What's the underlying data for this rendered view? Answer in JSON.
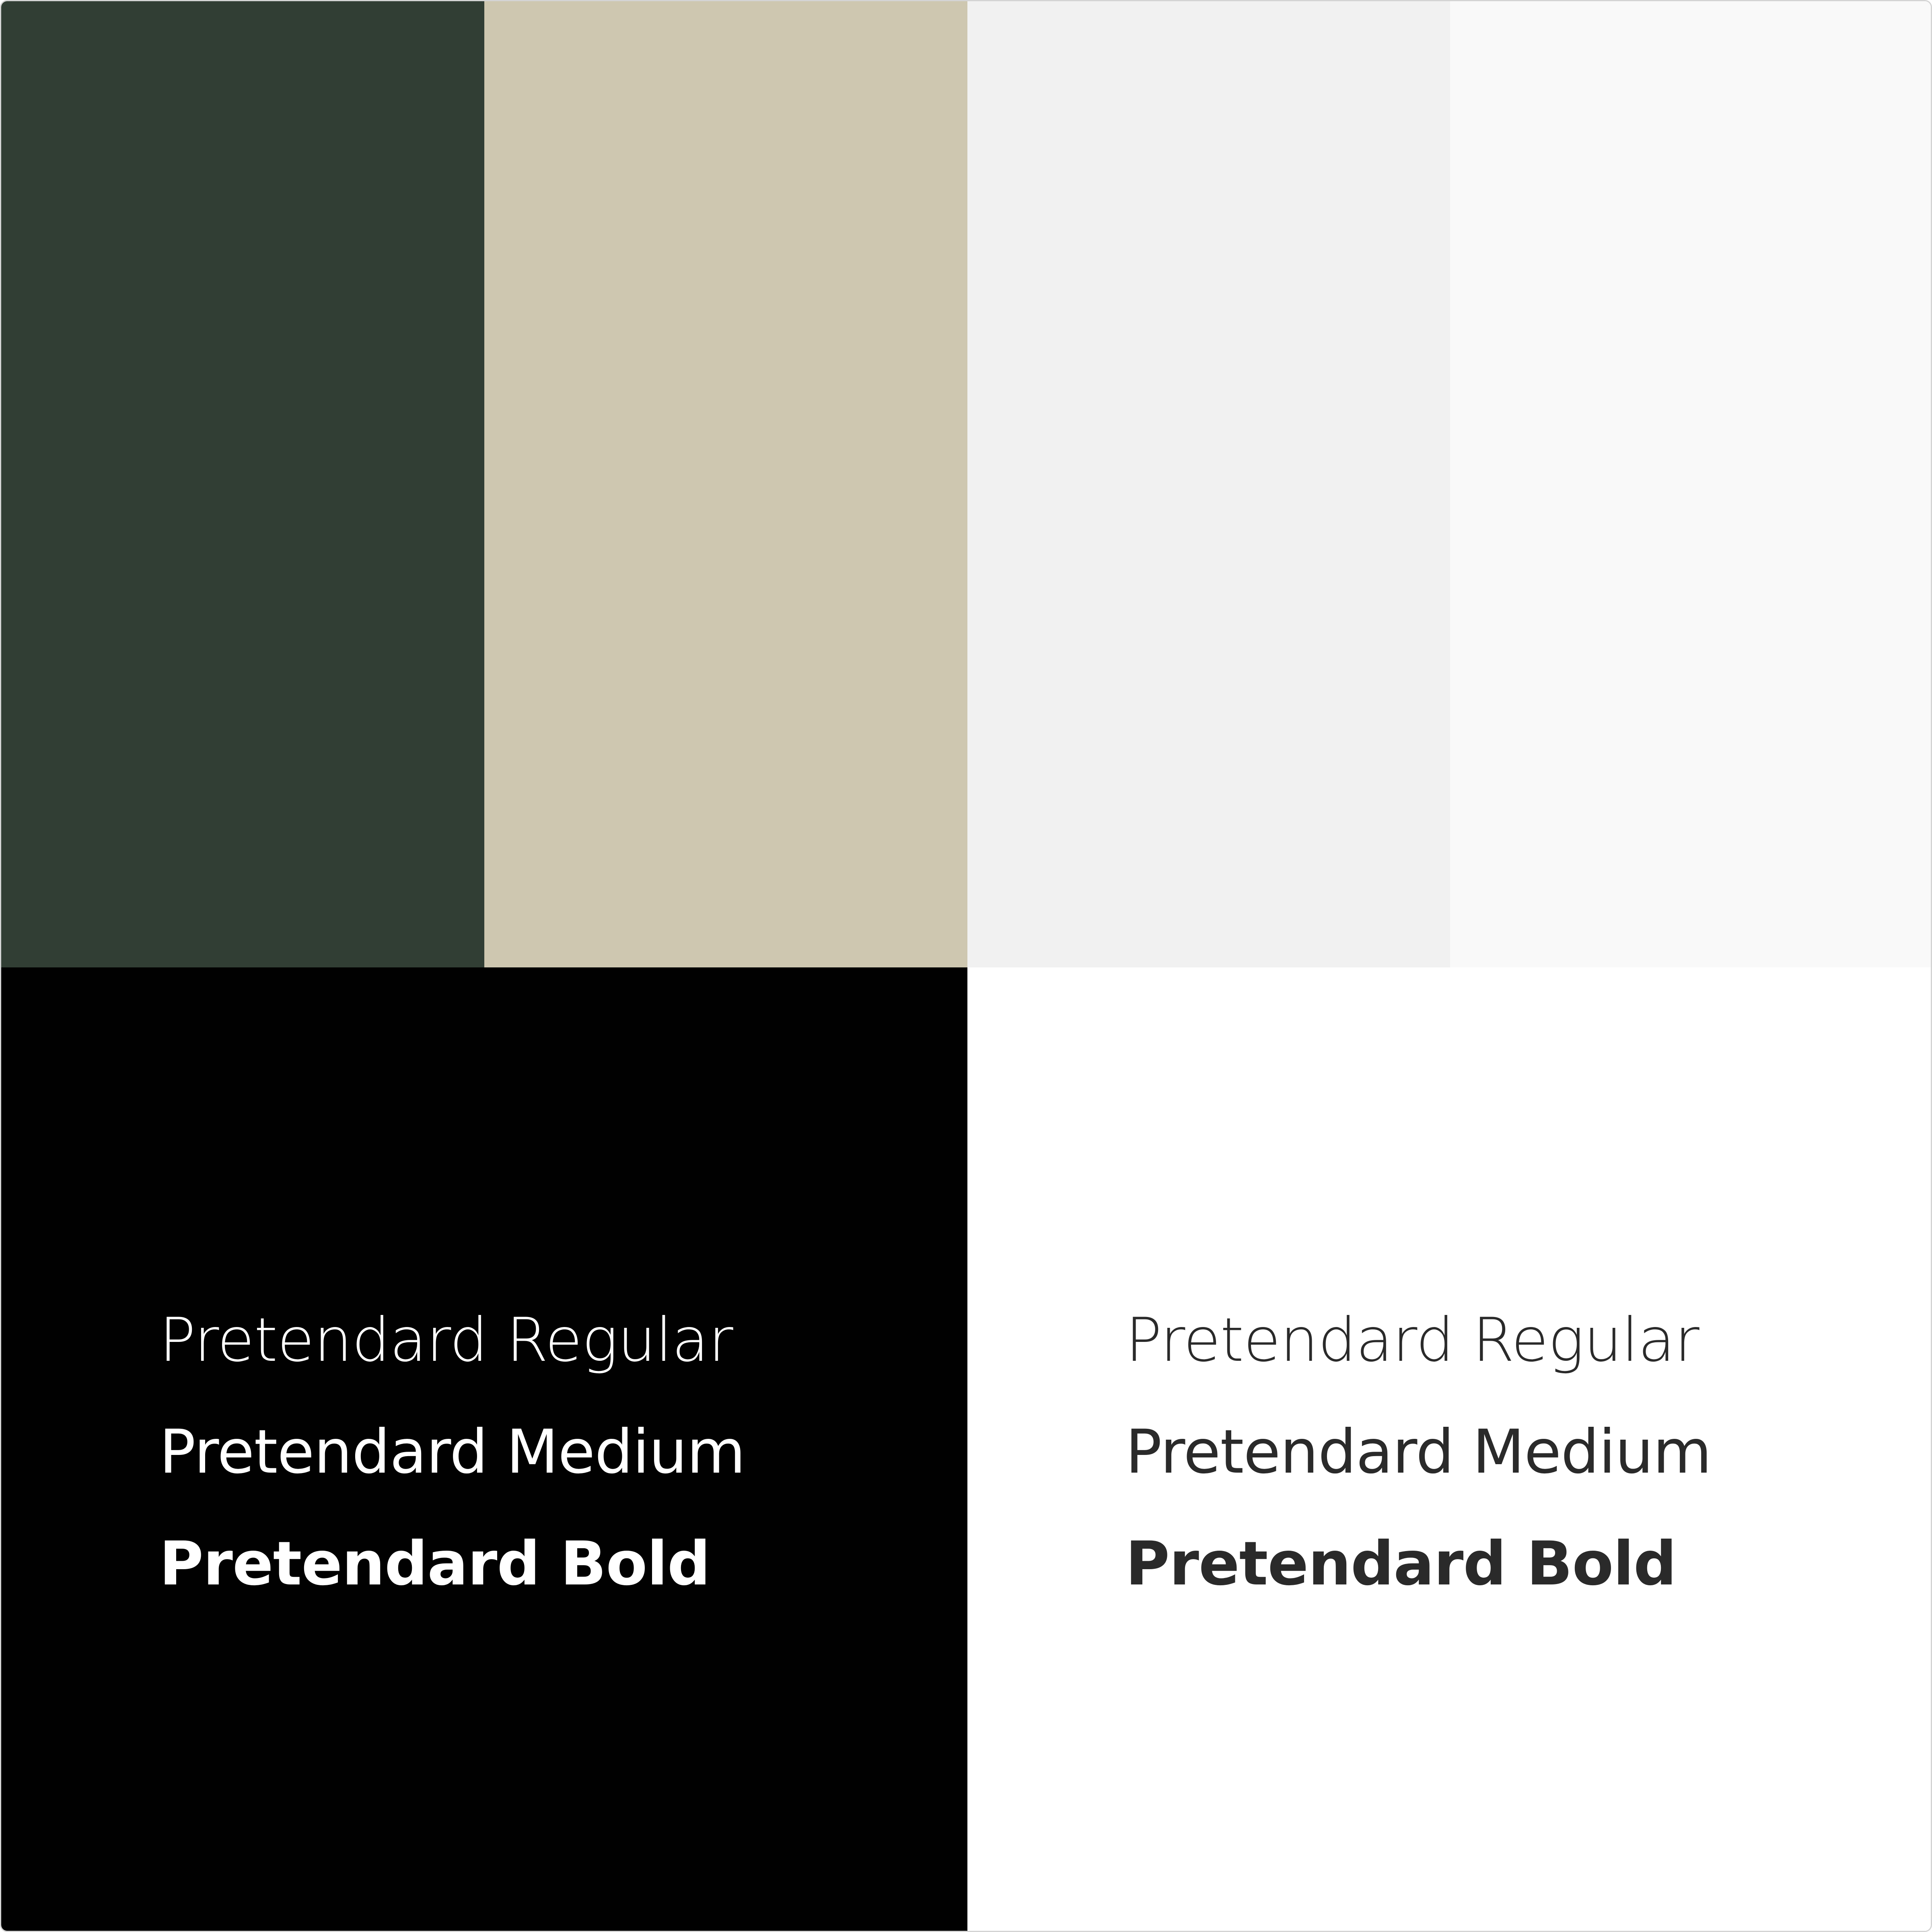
{
  "palette": {
    "swatches": [
      {
        "name": "dark-green",
        "color": "#313e34"
      },
      {
        "name": "beige",
        "color": "#cec7b0"
      },
      {
        "name": "light-gray",
        "color": "#f1f1f1"
      },
      {
        "name": "off-white",
        "color": "#f9f9f9"
      }
    ]
  },
  "typography": {
    "dark_panel": {
      "background": "#010101",
      "text_color": "#ffffff",
      "samples": [
        "Pretendard Regular",
        "Pretendard Medium",
        "Pretendard Bold"
      ]
    },
    "light_panel": {
      "background": "#ffffff",
      "text_color": "#2a2a2a",
      "samples": [
        "Pretendard Regular",
        "Pretendard Medium",
        "Pretendard Bold"
      ]
    }
  }
}
